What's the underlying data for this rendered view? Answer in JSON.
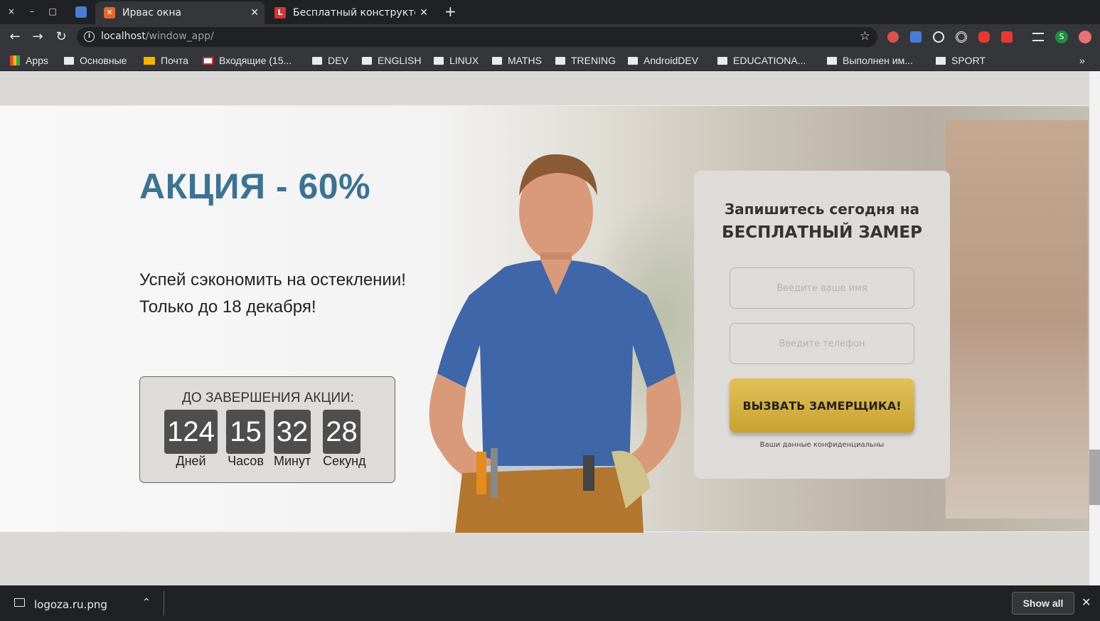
{
  "browser": {
    "window_controls": {
      "close": "×",
      "minimize": "–",
      "maximize": "□"
    },
    "tabs": [
      {
        "title": "Ирвас окна",
        "favicon": "xampp-icon",
        "favicon_color": "#e8672b",
        "active": true
      },
      {
        "title": "Бесплатный конструктор",
        "favicon": "L-icon",
        "favicon_color": "#d63436",
        "active": false
      }
    ],
    "new_tab": "+",
    "address": {
      "host": "localhost",
      "path": "/window_app/"
    },
    "bookmarks": [
      {
        "label": "Apps",
        "icon": "apps-grid-icon"
      },
      {
        "label": "Основные",
        "icon": "folder-icon"
      },
      {
        "label": "Почта",
        "icon": "mail-icon"
      },
      {
        "label": "Входящие (15...",
        "icon": "gmail-icon"
      },
      {
        "label": "DEV",
        "icon": "folder-icon"
      },
      {
        "label": "ENGLISH",
        "icon": "folder-icon"
      },
      {
        "label": "LINUX",
        "icon": "folder-icon"
      },
      {
        "label": "MATHS",
        "icon": "folder-icon"
      },
      {
        "label": "TRENING",
        "icon": "folder-icon"
      },
      {
        "label": "AndroidDEV",
        "icon": "folder-icon"
      },
      {
        "label": "EDUCATIONA...",
        "icon": "folder-icon"
      },
      {
        "label": "Выполнен им...",
        "icon": "folder-icon"
      },
      {
        "label": "SPORT",
        "icon": "folder-icon"
      }
    ],
    "bookmarks_more": "»",
    "profile_initial": "S"
  },
  "page": {
    "promo_title": "АКЦИЯ - 60%",
    "subtitle_line1": "Успей сэкономить на остеклении!",
    "subtitle_line2": "Только до 18 декабря!",
    "timer": {
      "title": "ДО ЗАВЕРШЕНИЯ АКЦИИ:",
      "days": "124",
      "days_label": "Дней",
      "hours": "15",
      "hours_label": "Часов",
      "minutes": "32",
      "minutes_label": "Минут",
      "seconds": "28",
      "seconds_label": "Секунд"
    },
    "form": {
      "heading_line1": "Запишитесь сегодня на",
      "heading_line2": "БЕСПЛАТНЫЙ ЗАМЕР",
      "name_placeholder": "Введите ваше имя",
      "phone_placeholder": "Введите телефон",
      "submit": "ВЫЗВАТЬ ЗАМЕРЩИКА!",
      "privacy": "Ваши данные конфиденциальны"
    }
  },
  "downloads": {
    "file": "logoza.ru.png",
    "show_all": "Show all"
  },
  "colors": {
    "accent": "#3d7392",
    "cta": "#d4b040",
    "chrome_dark": "#202124",
    "chrome_mid": "#35363a"
  }
}
